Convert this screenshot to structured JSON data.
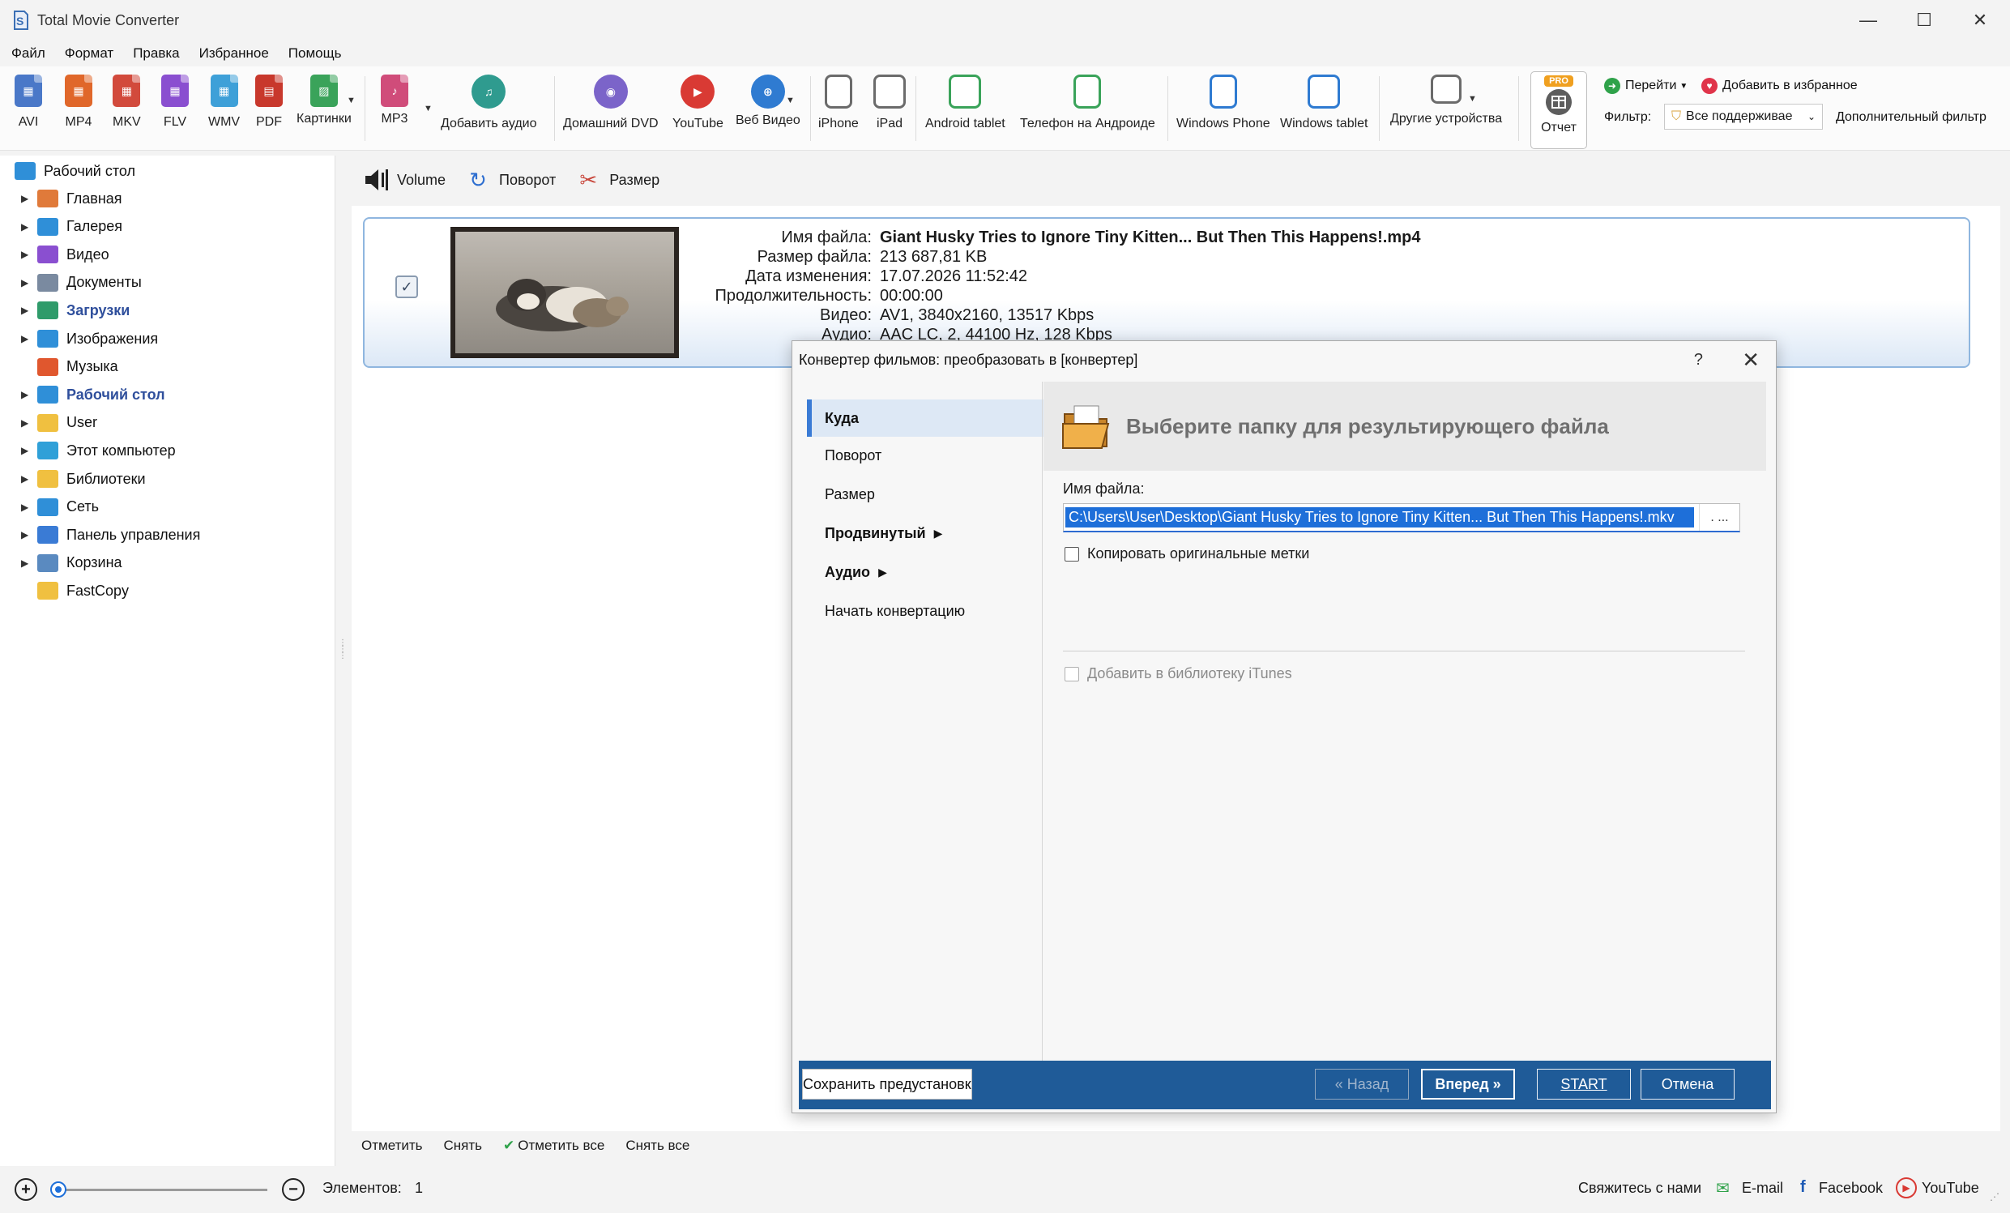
{
  "window": {
    "title": "Total Movie Converter",
    "controls": {
      "minimize": "—",
      "maximize": "☐",
      "close": "✕"
    }
  },
  "menu": [
    "Файл",
    "Формат",
    "Правка",
    "Избранное",
    "Помощь"
  ],
  "toolbar": {
    "formats": [
      {
        "label": "AVI",
        "icon": "avi-icon",
        "color": "#4a78c8"
      },
      {
        "label": "MP4",
        "icon": "mp4-icon",
        "color": "#e0672a"
      },
      {
        "label": "MKV",
        "icon": "mkv-icon",
        "color": "#d24a3c"
      },
      {
        "label": "FLV",
        "icon": "flv-icon",
        "color": "#8a4fd0"
      },
      {
        "label": "WMV",
        "icon": "wmv-icon",
        "color": "#3ea0d8"
      },
      {
        "label": "PDF",
        "icon": "pdf-icon",
        "color": "#c8382c"
      },
      {
        "label": "Картинки",
        "icon": "image-icon",
        "color": "#3aa35a"
      }
    ],
    "audio": [
      {
        "label": "MP3",
        "icon": "music-icon",
        "color": "#d04c7a"
      },
      {
        "label": "Добавить аудио",
        "icon": "add-audio-icon",
        "color": "#2f9b8f"
      }
    ],
    "web": [
      {
        "label": "Домашний DVD",
        "icon": "dvd-icon",
        "color": "#7b64c9"
      },
      {
        "label": "YouTube",
        "icon": "youtube-icon",
        "color": "#d93a34"
      },
      {
        "label": "Веб Видео",
        "icon": "web-video-icon",
        "color": "#2f7bd1"
      }
    ],
    "devices": [
      {
        "label": "iPhone",
        "icon": "iphone-icon"
      },
      {
        "label": "iPad",
        "icon": "ipad-icon"
      },
      {
        "label": "Android tablet",
        "icon": "android-tablet-icon"
      },
      {
        "label": "Телефон на Андроиде",
        "icon": "android-phone-icon"
      },
      {
        "label": "Windows Phone",
        "icon": "windows-phone-icon"
      },
      {
        "label": "Windows tablet",
        "icon": "windows-tablet-icon"
      },
      {
        "label": "Другие устройства",
        "icon": "other-devices-icon"
      }
    ],
    "report": {
      "badge": "PRO",
      "label": "Отчет"
    },
    "goto_label": "Перейти",
    "add_favorite_label": "Добавить в избранное",
    "filter_label": "Фильтр:",
    "filter_value": "Все поддерживае",
    "extra_filter_label": "Дополнительный фильтр"
  },
  "sidebar": {
    "root": "Рабочий стол",
    "items": [
      {
        "label": "Главная",
        "icon": "home-icon",
        "expandable": true,
        "bold": false
      },
      {
        "label": "Галерея",
        "icon": "gallery-icon",
        "expandable": true,
        "bold": false
      },
      {
        "label": "Видео",
        "icon": "video-folder-icon",
        "expandable": true,
        "bold": false
      },
      {
        "label": "Документы",
        "icon": "documents-icon",
        "expandable": true,
        "bold": false
      },
      {
        "label": "Загрузки",
        "icon": "downloads-icon",
        "expandable": true,
        "bold": true
      },
      {
        "label": "Изображения",
        "icon": "pictures-icon",
        "expandable": true,
        "bold": false
      },
      {
        "label": "Музыка",
        "icon": "music-folder-icon",
        "expandable": false,
        "bold": false
      },
      {
        "label": "Рабочий стол",
        "icon": "desktop-icon",
        "expandable": true,
        "bold": true
      },
      {
        "label": "User",
        "icon": "user-folder-icon",
        "expandable": true,
        "bold": false
      },
      {
        "label": "Этот компьютер",
        "icon": "computer-icon",
        "expandable": true,
        "bold": false
      },
      {
        "label": "Библиотеки",
        "icon": "libraries-icon",
        "expandable": true,
        "bold": false
      },
      {
        "label": "Сеть",
        "icon": "network-icon",
        "expandable": true,
        "bold": false
      },
      {
        "label": "Панель управления",
        "icon": "control-panel-icon",
        "expandable": true,
        "bold": false
      },
      {
        "label": "Корзина",
        "icon": "recycle-bin-icon",
        "expandable": true,
        "bold": false
      },
      {
        "label": "FastCopy",
        "icon": "folder-icon",
        "expandable": false,
        "bold": false
      }
    ]
  },
  "content_toolbar": {
    "volume": "Volume",
    "rotate": "Поворот",
    "size": "Размер"
  },
  "file": {
    "checked": true,
    "rows": [
      {
        "key": "Имя файла:",
        "value": "Giant Husky Tries to Ignore Tiny Kitten... But Then This Happens!.mp4",
        "bold": true
      },
      {
        "key": "Размер файла:",
        "value": "213 687,81 KB",
        "bold": false
      },
      {
        "key": "Дата изменения:",
        "value": "17.07.2026 11:52:42",
        "bold": false
      },
      {
        "key": "Продолжительность:",
        "value": "00:00:00",
        "bold": false
      },
      {
        "key": "Видео:",
        "value": "AV1, 3840x2160, 13517 Kbps",
        "bold": false
      },
      {
        "key": "Аудио:",
        "value": "AAC LC, 2, 44100 Hz, 128 Kbps",
        "bold": false
      }
    ]
  },
  "bottom_actions": {
    "mark": "Отметить",
    "unmark": "Снять",
    "mark_all": "Отметить все",
    "unmark_all": "Снять все"
  },
  "status": {
    "items_label": "Элементов:",
    "items_count": "1",
    "zoom_level": 0.0,
    "contact": "Свяжитесь с нами",
    "email": "E-mail",
    "facebook": "Facebook",
    "youtube": "YouTube"
  },
  "dialog": {
    "title": "Конвертер фильмов: преобразовать в [конвертер]",
    "help": "?",
    "close": "✕",
    "nav": [
      "Куда",
      "Поворот",
      "Размер",
      "Продвинутый",
      "Аудио",
      "Начать конвертацию"
    ],
    "header": "Выберите папку для результирующего файла",
    "filename_label": "Имя файла:",
    "filename_value": "C:\\Users\\User\\Desktop\\Giant Husky Tries to Ignore Tiny Kitten... But Then This Happens!.mkv",
    "browse_label": ". ...",
    "copy_tags_label": "Копировать оригинальные метки",
    "itunes_label": "Добавить в библиотеку iTunes",
    "buttons": {
      "save_preset": "Сохранить предустановк",
      "back": "« Назад",
      "next": "Вперед »",
      "start": "START",
      "cancel": "Отмена"
    }
  },
  "colors": {
    "accent": "#1e6fd9",
    "dialog_footer": "#1f5b98",
    "card_border": "#8fb6df"
  }
}
